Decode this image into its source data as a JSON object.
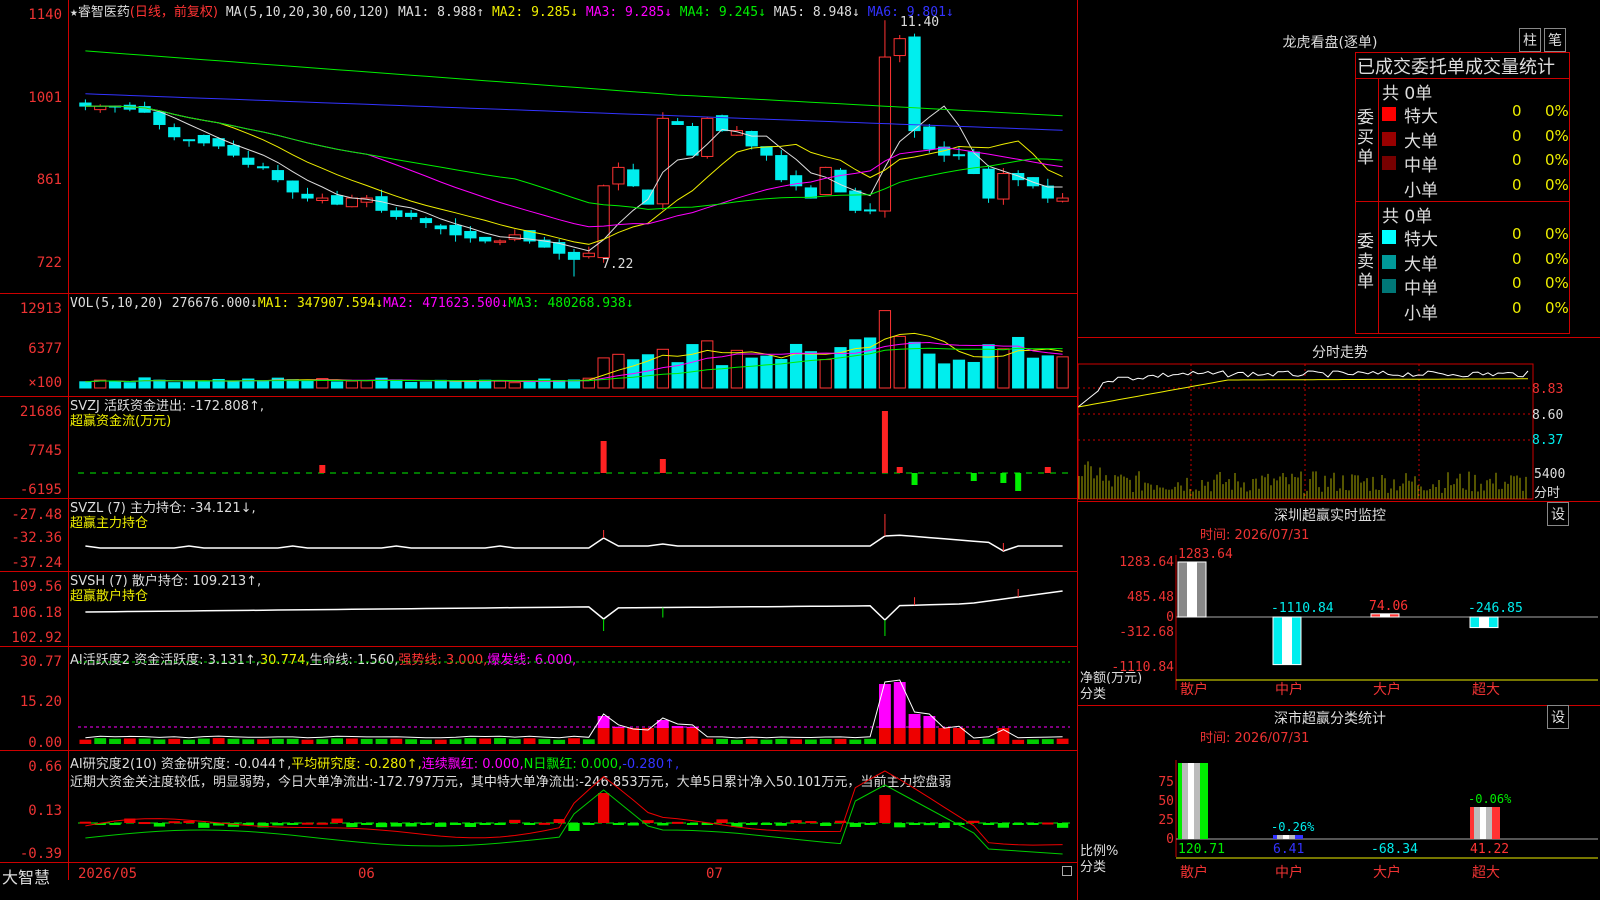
{
  "stock": {
    "star": "★",
    "name": "睿智医药",
    "mode": "(日线，前复权)"
  },
  "main_header": {
    "ma_label": "MA(5,10,20,30,60,120)",
    "items": [
      {
        "text": "MA1: 8.988↑",
        "color": "#ddd"
      },
      {
        "text": "MA2: 9.285↓",
        "color": "#ee0"
      },
      {
        "text": "MA3: 9.285↓",
        "color": "#f0f"
      },
      {
        "text": "MA4: 9.245↓",
        "color": "#0e0"
      },
      {
        "text": "MA5: 8.948↓",
        "color": "#ddd"
      },
      {
        "text": "MA6: 9.801↓",
        "color": "#33f"
      }
    ]
  },
  "main_axis": [
    "1140",
    "1001",
    "861",
    "722"
  ],
  "annotations": {
    "high": "11.40",
    "low": "7.22"
  },
  "vol_header": {
    "label": "VOL(5,10,20)",
    "value": "276676.000↓",
    "ma1": "MA1: 347907.594↓",
    "ma2": "MA2: 471623.500↓",
    "ma3": "MA3: 480268.938↓"
  },
  "vol_axis": [
    "12913",
    "6377",
    "×100"
  ],
  "svzj_header": {
    "l1": "SVZJ  活跃资金进出: -172.808↑,",
    "l2": "超赢资金流(万元)"
  },
  "svzj_axis": [
    "21686",
    "7745",
    "-6195"
  ],
  "svzl_header": {
    "l1": "SVZL (7) 主力持仓: -34.121↓,",
    "l2": "超赢主力持仓"
  },
  "svzl_axis": [
    "-27.48",
    "-32.36",
    "-37.24"
  ],
  "svsh_header": {
    "l1": "SVSH (7) 散户持仓: 109.213↑,",
    "l2": "超赢散户持仓"
  },
  "svsh_axis": [
    "109.56",
    "106.18",
    "102.92"
  ],
  "ai_header": {
    "a": "AI活跃度2 资金活跃度: 3.131↑,",
    "b": "30.774,",
    "c": "生命线: 1.560,",
    "d": "强势线: 3.000,",
    "e": "爆发线: 6.000,"
  },
  "ai_axis": [
    "30.77",
    "15.20",
    "0.00"
  ],
  "air_header": {
    "a": "AI研究度2(10) 资金研究度: -0.044↑,",
    "b": "平均研究度: -0.280↑,",
    "c": "连续飘红: 0.000,",
    "d": "N日飘红: 0.000,",
    "e": "-0.280↑,"
  },
  "air_text": "近期大资金关注度较低，明显弱势，今日大单净流出:-172.797万元，其中特大单净流出:-246.853万元，大单5日累计净入50.101万元，当前主力控盘弱",
  "air_axis": [
    "0.66",
    "0.13",
    "-0.39"
  ],
  "bottom": {
    "brand": "大智慧",
    "dates": [
      "2026/05",
      "06",
      "07"
    ]
  },
  "right": {
    "lhb_title": "龙虎看盘(逐单)",
    "tabs": [
      "柱",
      "笔"
    ],
    "stats_title": "已成交委托单成交量统计",
    "buy": {
      "label": "委买单",
      "count": "共 0单",
      "rows": [
        [
          "特大",
          "0",
          "0%"
        ],
        [
          "大单",
          "0",
          "0%"
        ],
        [
          "中单",
          "0",
          "0%"
        ],
        [
          "小单",
          "0",
          "0%"
        ]
      ]
    },
    "sell": {
      "label": "委卖单",
      "count": "共 0单",
      "rows": [
        [
          "特大",
          "0",
          "0%"
        ],
        [
          "大单",
          "0",
          "0%"
        ],
        [
          "中单",
          "0",
          "0%"
        ],
        [
          "小单",
          "0",
          "0%"
        ]
      ]
    },
    "intraday_title": "分时走势",
    "intraday_axis": [
      "8.83",
      "8.60",
      "8.37"
    ],
    "intraday_vol": "5400",
    "intraday_vol_unit": "分时",
    "sz_monitor": {
      "title": "深圳超赢实时监控",
      "settings": "设",
      "time": "时间: 2026/07/31",
      "axis": [
        "1283.64",
        "485.48",
        "0",
        "-312.68",
        "-1110.84"
      ],
      "unit1": "净额(万元)",
      "unit2": "分类",
      "cats": [
        "散户",
        "中户",
        "大户",
        "超大"
      ],
      "values": [
        "1283.64",
        "-1110.84",
        "74.06",
        "-246.85"
      ]
    },
    "sz_class": {
      "title": "深市超赢分类统计",
      "settings": "设",
      "time": "时间: 2026/07/31",
      "axis": [
        "75",
        "50",
        "25",
        "0"
      ],
      "unit1": "比例%",
      "unit2": "分类",
      "cats": [
        "散户",
        "中户",
        "大户",
        "超大"
      ],
      "top_labels": [
        "",
        "-0.26%",
        "",
        "-0.06%"
      ],
      "bottom_labels": [
        "120.71",
        "6.41",
        "-68.34",
        "41.22"
      ]
    }
  },
  "chart_data": {
    "type": "candlestick",
    "title": "睿智医药 (日线，前复权)",
    "price_range": [
      7.22,
      11.4
    ],
    "candles_close_approx": [
      10.0,
      10.0,
      10.0,
      9.95,
      9.9,
      9.7,
      9.5,
      9.45,
      9.4,
      9.35,
      9.2,
      9.05,
      9.0,
      8.8,
      8.6,
      8.5,
      8.5,
      8.4,
      8.5,
      8.5,
      8.3,
      8.2,
      8.2,
      8.1,
      8.0,
      7.9,
      7.85,
      7.8,
      7.8,
      7.9,
      7.8,
      7.7,
      7.6,
      7.5,
      7.6,
      8.7,
      9.0,
      8.7,
      8.4,
      9.8,
      9.7,
      9.2,
      9.8,
      9.6,
      9.6,
      9.35,
      9.2,
      8.8,
      8.7,
      8.5,
      9.0,
      8.6,
      8.3,
      8.3,
      10.8,
      11.1,
      9.6,
      9.3,
      9.2,
      9.2,
      8.9,
      8.5,
      8.9,
      8.8,
      8.7,
      8.5,
      8.5
    ],
    "volume_axis_x100": [
      6377,
      12913
    ],
    "svzj_range": [
      -6195,
      21686
    ],
    "svzl_range": [
      -37.24,
      -27.48
    ],
    "svsh_range": [
      102.92,
      109.56
    ],
    "ai_activity_range": [
      0,
      30.77
    ],
    "ai_research_range": [
      -0.39,
      0.66
    ],
    "sz_monitor_values": {
      "散户": 1283.64,
      "中户": -1110.84,
      "大户": 74.06,
      "超大": -246.85
    },
    "sz_class_values": {
      "散户": 120.71,
      "中户": 6.41,
      "大户": -68.34,
      "超大": 41.22
    }
  }
}
